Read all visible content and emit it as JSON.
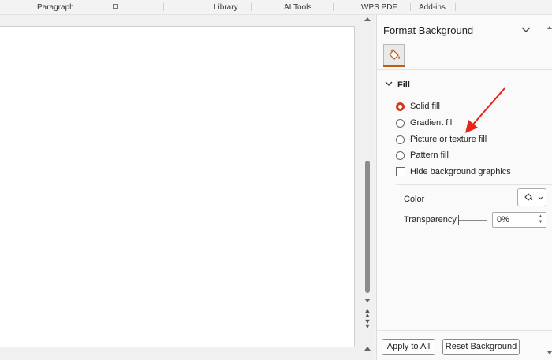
{
  "ribbon": {
    "groups": {
      "paragraph": "Paragraph",
      "library": "Library",
      "ai_tools": "AI Tools",
      "wps_pdf": "WPS PDF",
      "add_ins": "Add-ins"
    }
  },
  "pane": {
    "title": "Format Background",
    "fill_section": "Fill",
    "options": {
      "solid": "Solid fill",
      "gradient": "Gradient fill",
      "picture": "Picture or texture fill",
      "pattern": "Pattern fill"
    },
    "selected_option": "Solid fill",
    "hide_graphics": "Hide background graphics",
    "hide_graphics_checked": false,
    "color_label": "Color",
    "transparency_label": "Transparency",
    "transparency_value": "0%",
    "apply_all": "Apply to All",
    "reset_bg": "Reset Background"
  },
  "colors": {
    "accent": "#d13b1c",
    "annotation_arrow": "#e8231a",
    "tab_underline": "#c55a11"
  },
  "icons": {
    "fill_tab": "paint-bucket-icon",
    "collapse": "chevron-down-icon",
    "section_toggle": "chevron-down-icon",
    "color_picker": "paint-bucket-icon"
  }
}
